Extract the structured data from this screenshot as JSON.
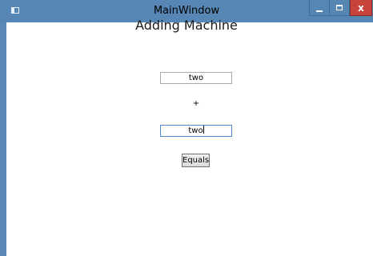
{
  "window": {
    "title": "MainWindow",
    "close_glyph": "x"
  },
  "main": {
    "heading": "Adding Machine",
    "first_input": {
      "value": "two"
    },
    "operator": "+",
    "second_input": {
      "value": "two"
    },
    "equals_label": "Equals"
  },
  "colors": {
    "titlebar": "#5686b4",
    "close_button": "#c7443a",
    "focus_border": "#4f88c9"
  },
  "icons": {
    "app": "app-window-icon",
    "minimize": "minimize-icon",
    "maximize": "maximize-icon",
    "close": "close-icon"
  }
}
